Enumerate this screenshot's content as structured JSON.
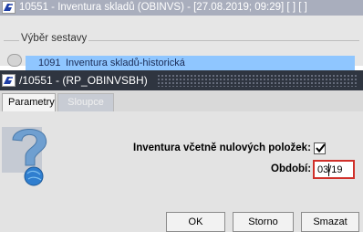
{
  "background_window": {
    "title": "10551 - Inventura skladů (OBINVS) - [27.08.2019; 09:29] [ ] [ ]",
    "fieldset_legend": "Výběr sestavy",
    "list_row": {
      "number": "1091",
      "name": "Inventura skladů-historická"
    }
  },
  "dialog": {
    "title": "/10551 - (RP_OBINVSBH)",
    "tabs": [
      {
        "label": "Parametry",
        "active": true
      },
      {
        "label": "Sloupce",
        "active": false
      }
    ],
    "fields": {
      "include_zero_label": "Inventura včetně nulových položek:",
      "include_zero_checked": true,
      "period_label": "Období:",
      "period_value": "03/19"
    },
    "buttons": {
      "ok": "OK",
      "storno": "Storno",
      "smazat": "Smazat"
    }
  },
  "colors": {
    "selection": "#8fc6ff",
    "dialog_titlebar": "#2f3540",
    "error_border": "#d0302a"
  }
}
